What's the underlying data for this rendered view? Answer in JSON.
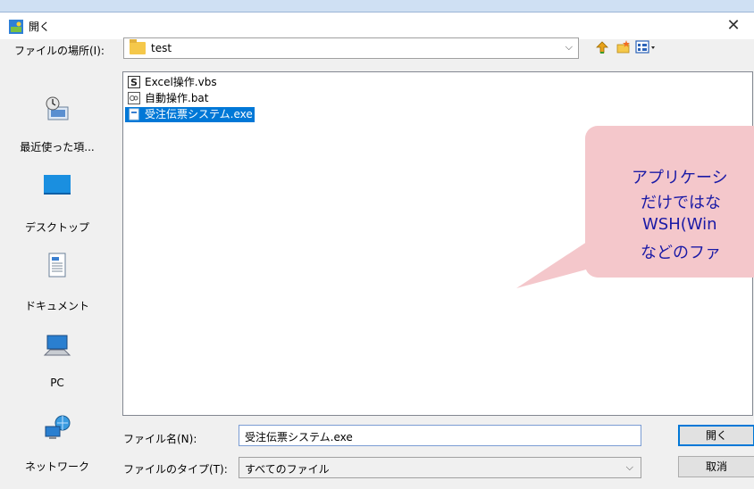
{
  "dialog": {
    "title": "開く",
    "close_glyph": "✕"
  },
  "lookin": {
    "label": "ファイルの場所(I):",
    "value": "test"
  },
  "places": [
    {
      "label": "最近使った項...",
      "icon": "recent-places-icon"
    },
    {
      "label": "デスクトップ",
      "icon": "desktop-icon"
    },
    {
      "label": "ドキュメント",
      "icon": "documents-icon"
    },
    {
      "label": "PC",
      "icon": "pc-icon"
    },
    {
      "label": "ネットワーク",
      "icon": "network-icon"
    }
  ],
  "files": [
    {
      "name": "Excel操作.vbs",
      "icon": "vbs-file-icon",
      "selected": false
    },
    {
      "name": "自動操作.bat",
      "icon": "bat-file-icon",
      "selected": false
    },
    {
      "name": "受注伝票システム.exe",
      "icon": "exe-file-icon",
      "selected": true
    }
  ],
  "callout": {
    "lines": [
      "アプリケーシ",
      "だけではな",
      "WSH(Win",
      "などのファ"
    ]
  },
  "filename": {
    "label": "ファイル名(N):",
    "value": "受注伝票システム.exe"
  },
  "filetype": {
    "label": "ファイルのタイプ(T):",
    "value": "すべてのファイル"
  },
  "buttons": {
    "open": "開く",
    "cancel": "取消"
  },
  "colors": {
    "selection": "#0078d7",
    "callout_bg": "#f4c7cb",
    "callout_text": "#1a1aa6"
  }
}
